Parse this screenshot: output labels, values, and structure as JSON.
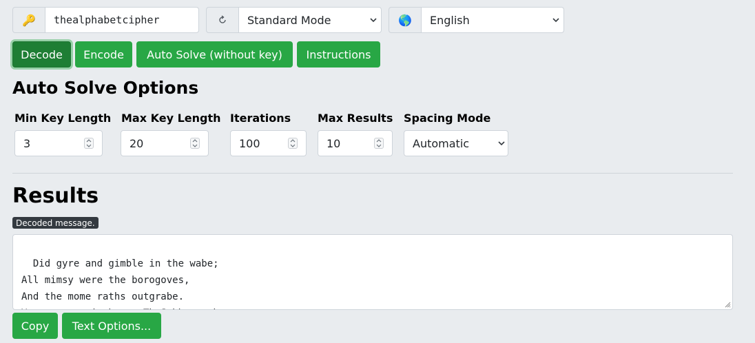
{
  "toolbar": {
    "key_icon": "key-icon",
    "key_value": "thealphabetcipher",
    "mode_icon": "refresh-icon",
    "mode_selected": "Standard Mode",
    "lang_icon": "globe-icon",
    "lang_selected": "English"
  },
  "actions": {
    "decode": "Decode",
    "encode": "Encode",
    "auto_solve": "Auto Solve (without key)",
    "instructions": "Instructions"
  },
  "auto_solve": {
    "heading": "Auto Solve Options",
    "min_key_label": "Min Key Length",
    "min_key_value": "3",
    "max_key_label": "Max Key Length",
    "max_key_value": "20",
    "iterations_label": "Iterations",
    "iterations_value": "100",
    "max_results_label": "Max Results",
    "max_results_value": "10",
    "spacing_label": "Spacing Mode",
    "spacing_value": "Automatic"
  },
  "results": {
    "heading": "Results",
    "badge": "Decoded message.",
    "text": "Did gyre and gimble in the wabe;\nAll mimsy were the borogoves,\nAnd the mome raths outgrabe.\nYour secret is bewareTheJabberwock",
    "copy": "Copy",
    "text_options": "Text Options..."
  },
  "colors": {
    "accent": "#28a745",
    "accent_active": "#1e7e34",
    "background": "#e9ecef"
  }
}
